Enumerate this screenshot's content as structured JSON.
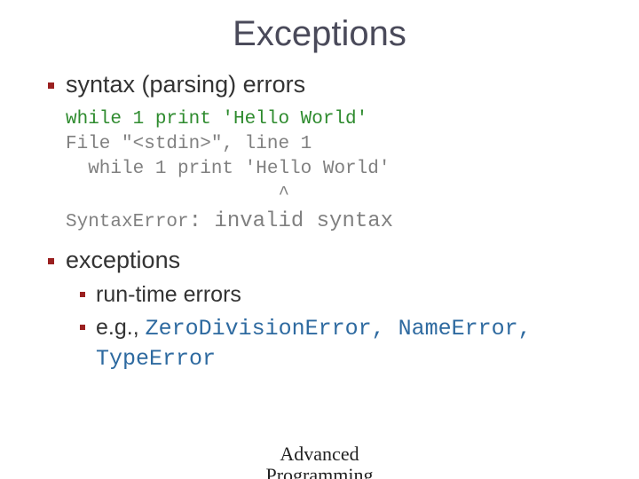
{
  "title": "Exceptions",
  "bullets": {
    "b1": "syntax (parsing) errors",
    "code": {
      "l1": "while 1 print 'Hello World'",
      "l2": "File \"<stdin>\", line 1",
      "l3": "  while 1 print 'Hello World'",
      "l4": "                   ^",
      "l5a": "SyntaxError",
      "l5b": ": invalid syntax"
    },
    "b2": "exceptions",
    "b2_sub1": "run-time errors",
    "b2_sub2_prefix": "e.g., ",
    "b2_sub2_types": "ZeroDivisionError, NameError, TypeError"
  },
  "footer": {
    "line1": "Advanced",
    "line2": "Programming"
  }
}
